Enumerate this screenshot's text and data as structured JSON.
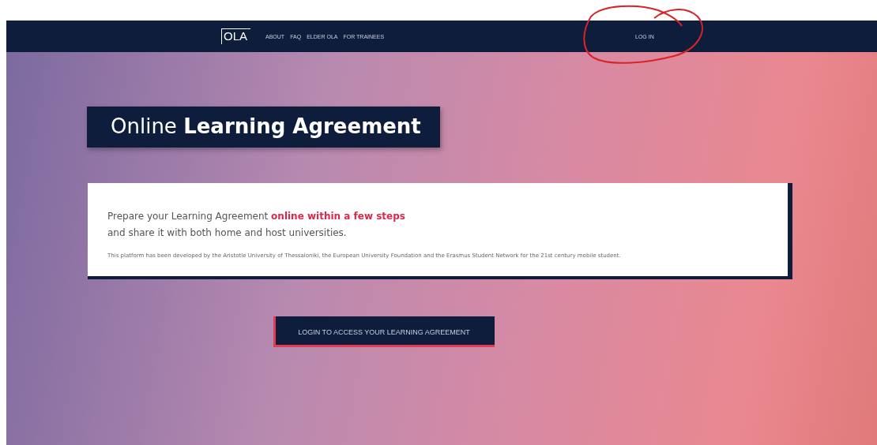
{
  "navbar": {
    "logo": "OLA",
    "links": [
      {
        "label": "ABOUT"
      },
      {
        "label": "FAQ"
      },
      {
        "label": "ELDER OLA"
      },
      {
        "label": "FOR TRAINEES"
      }
    ],
    "login": "LOG IN"
  },
  "hero": {
    "title": "Online **Learning Agreement**",
    "intro_lines": [
      "Prepare your Learning Agreement **online within a few steps**",
      "and share it with both home and host universities."
    ],
    "note": "This platform has been developed by the Aristotle University of Thessaloniki, the European University Foundation and the Erasmus Student Network for the 21st century mobile student.",
    "button": "LOGIN TO ACCESS YOUR LEARNING AGREEMENT"
  }
}
